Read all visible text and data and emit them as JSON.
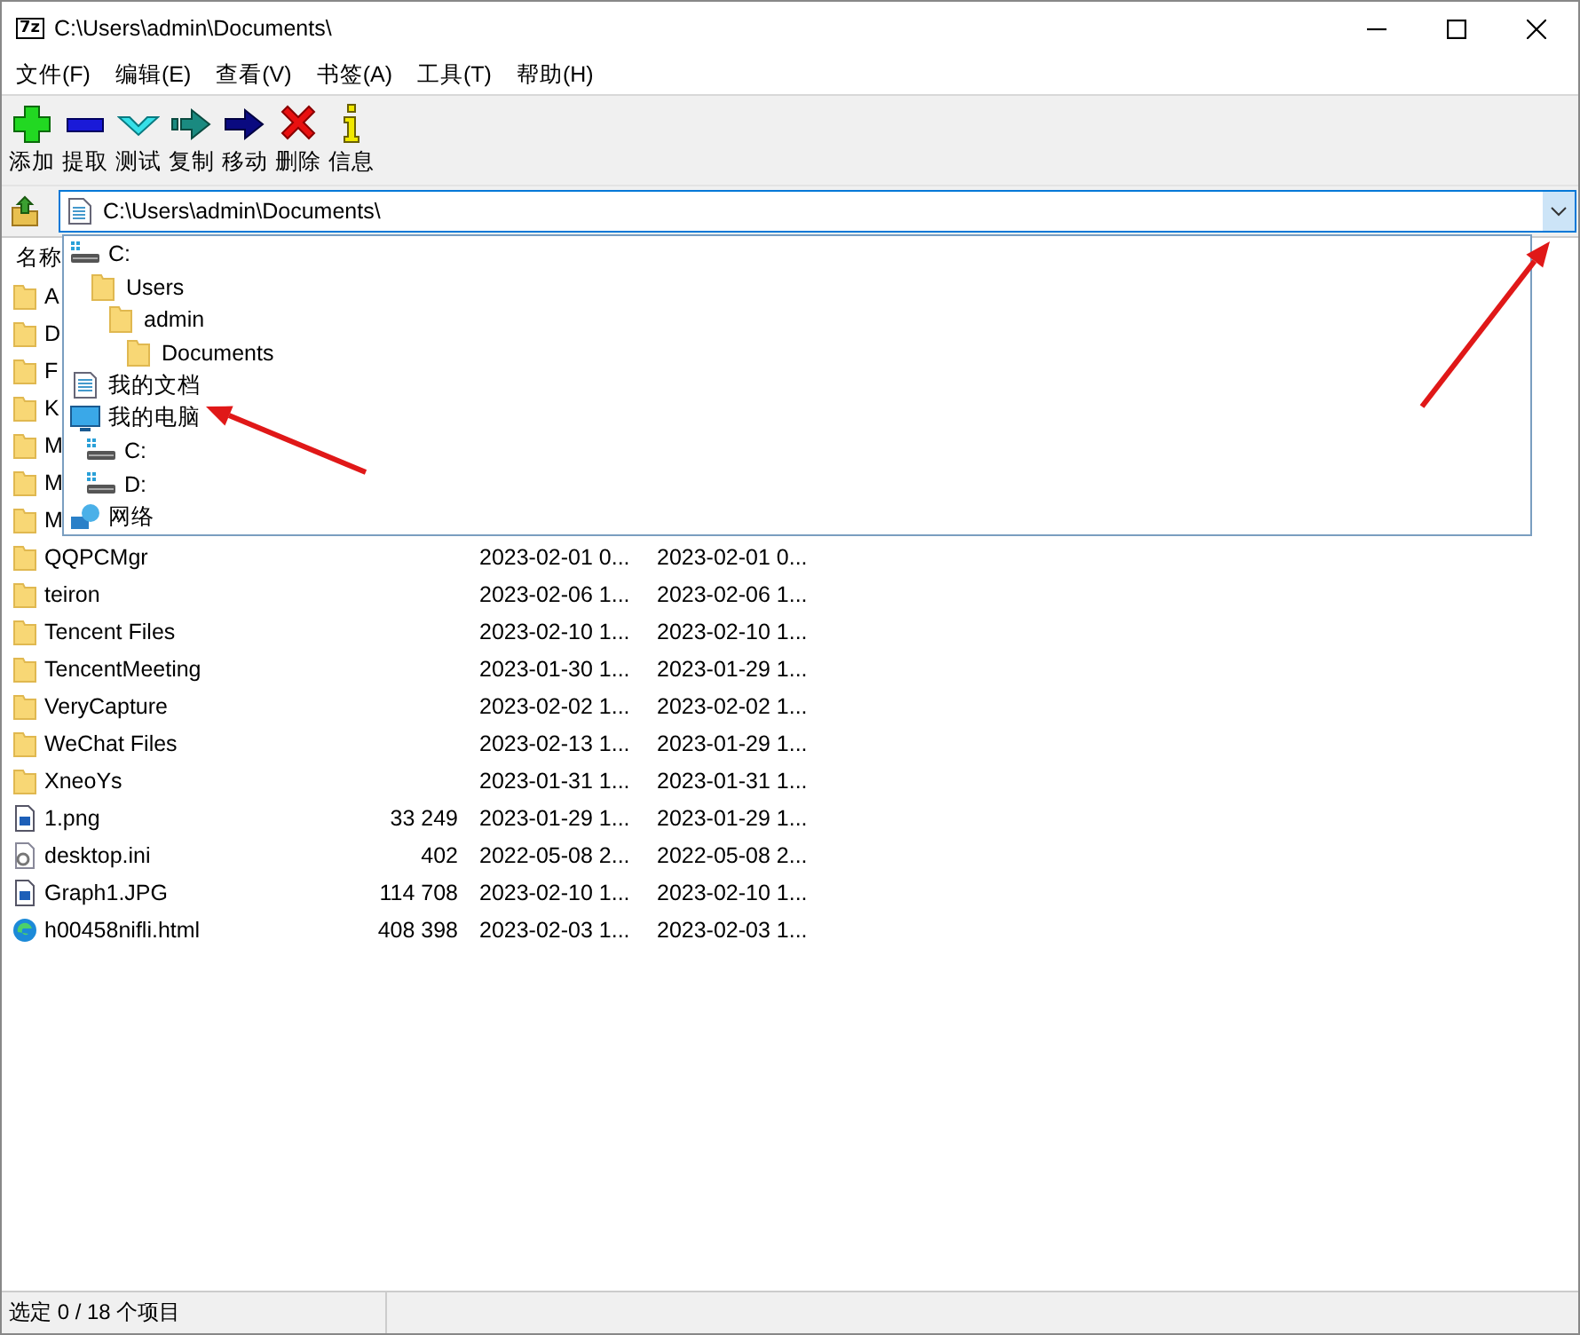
{
  "window": {
    "logo": "7z",
    "title": "C:\\Users\\admin\\Documents\\"
  },
  "menu": [
    "文件(F)",
    "编辑(E)",
    "查看(V)",
    "书签(A)",
    "工具(T)",
    "帮助(H)"
  ],
  "toolbar": [
    {
      "label": "添加",
      "kind": "add"
    },
    {
      "label": "提取",
      "kind": "extract"
    },
    {
      "label": "测试",
      "kind": "test"
    },
    {
      "label": "复制",
      "kind": "copy"
    },
    {
      "label": "移动",
      "kind": "move"
    },
    {
      "label": "删除",
      "kind": "delete"
    },
    {
      "label": "信息",
      "kind": "info"
    }
  ],
  "address": {
    "value": "C:\\Users\\admin\\Documents\\"
  },
  "columns": [
    "名称"
  ],
  "rows": [
    {
      "name": "A",
      "kind": "folder"
    },
    {
      "name": "D",
      "kind": "folder"
    },
    {
      "name": "F",
      "kind": "folder"
    },
    {
      "name": "K",
      "kind": "folder"
    },
    {
      "name": "M",
      "kind": "folder"
    },
    {
      "name": "M",
      "kind": "folder"
    },
    {
      "name": "M",
      "kind": "folder"
    },
    {
      "name": "QQPCMgr",
      "kind": "folder",
      "modified": "2023-02-01 0...",
      "created": "2023-02-01 0..."
    },
    {
      "name": "teiron",
      "kind": "folder",
      "modified": "2023-02-06 1...",
      "created": "2023-02-06 1..."
    },
    {
      "name": "Tencent Files",
      "kind": "folder",
      "modified": "2023-02-10 1...",
      "created": "2023-02-10 1..."
    },
    {
      "name": "TencentMeeting",
      "kind": "folder",
      "modified": "2023-01-30 1...",
      "created": "2023-01-29 1..."
    },
    {
      "name": "VeryCapture",
      "kind": "folder",
      "modified": "2023-02-02 1...",
      "created": "2023-02-02 1..."
    },
    {
      "name": "WeChat Files",
      "kind": "folder",
      "modified": "2023-02-13 1...",
      "created": "2023-01-29 1..."
    },
    {
      "name": "XneoYs",
      "kind": "folder",
      "modified": "2023-01-31 1...",
      "created": "2023-01-31 1..."
    },
    {
      "name": "1.png",
      "kind": "image",
      "size": "33 249",
      "modified": "2023-01-29 1...",
      "created": "2023-01-29 1..."
    },
    {
      "name": "desktop.ini",
      "kind": "settings",
      "size": "402",
      "modified": "2022-05-08 2...",
      "created": "2022-05-08 2..."
    },
    {
      "name": "Graph1.JPG",
      "kind": "image",
      "size": "114 708",
      "modified": "2023-02-10 1...",
      "created": "2023-02-10 1..."
    },
    {
      "name": "h00458nifli.html",
      "kind": "browser",
      "size": "408 398",
      "modified": "2023-02-03 1...",
      "created": "2023-02-03 1..."
    }
  ],
  "dropdown": [
    {
      "label": "C:",
      "kind": "drive",
      "children": [
        {
          "label": "Users",
          "kind": "folder",
          "children": [
            {
              "label": "admin",
              "kind": "folder",
              "children": [
                {
                  "label": "Documents",
                  "kind": "folder"
                }
              ]
            }
          ]
        }
      ]
    },
    {
      "label": "我的文档",
      "kind": "document"
    },
    {
      "label": "我的电脑",
      "kind": "computer",
      "children": [
        {
          "label": "C:",
          "kind": "drive"
        },
        {
          "label": "D:",
          "kind": "drive"
        }
      ]
    },
    {
      "label": "网络",
      "kind": "network"
    }
  ],
  "status_bar": "选定 0 / 18 个项目"
}
